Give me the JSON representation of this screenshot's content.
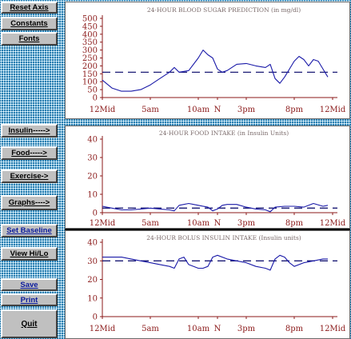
{
  "sidebar": {
    "reset_axis": "Reset Axis",
    "constants": "Constants",
    "fonts": "Fonts",
    "insulin": "Insulin----->",
    "food": "Food----->",
    "exercise": "Exercise->",
    "graphs": "Graphs---->",
    "set_baseline": "Set Baseline",
    "view_hilo": "View Hi/Lo",
    "save": "Save",
    "print": "Print",
    "quit": "Quit"
  },
  "charts": [
    {
      "id": "blood-sugar",
      "title": "24-HOUR BLOOD SUGAR PREDICTION (in mg/dl)",
      "y_ticks": [
        "0",
        "50",
        "100",
        "150",
        "200",
        "250",
        "300",
        "350",
        "400",
        "450",
        "500"
      ],
      "x_ticks": [
        "12Mid",
        "5am",
        "10am",
        "N",
        "3pm",
        "8pm",
        "12Mid"
      ]
    },
    {
      "id": "food",
      "title": "24-HOUR FOOD INTAKE (in Insulin Units)",
      "y_ticks": [
        "0",
        "10",
        "20",
        "30",
        "40"
      ],
      "x_ticks": [
        "12Mid",
        "5am",
        "10am",
        "N",
        "3pm",
        "8pm",
        "12Mid"
      ]
    },
    {
      "id": "bolus",
      "title": "24-HOUR BOLUS INSULIN INTAKE (Insulin units)",
      "y_ticks": [
        "0",
        "10",
        "20",
        "30",
        "40"
      ],
      "x_ticks": [
        "12Mid",
        "5am",
        "10am",
        "N",
        "3pm",
        "8pm",
        "12Mid"
      ]
    }
  ],
  "colors": {
    "axis": "#8b1a1a",
    "series": "#1a1aa8",
    "baseline": "#000066",
    "title": "#7a6a6a"
  },
  "chart_data": [
    {
      "type": "line",
      "title": "24-HOUR BLOOD SUGAR PREDICTION (in mg/dl)",
      "ylim": [
        0,
        500
      ],
      "xlim": [
        0,
        24
      ],
      "x_tick_hours": [
        0,
        5,
        10,
        12,
        15,
        20,
        24
      ],
      "baseline": 160,
      "series": [
        {
          "x": [
            0,
            1,
            2,
            3,
            4,
            5,
            6,
            7,
            7.5,
            8,
            9,
            10,
            10.5,
            11,
            11.5,
            12,
            12.5,
            13,
            14,
            15,
            16,
            17,
            17.5,
            18,
            18.5,
            19,
            20,
            20.5,
            21,
            21.5,
            22,
            22.5,
            23,
            23.5
          ],
          "y": [
            110,
            60,
            40,
            40,
            50,
            80,
            120,
            160,
            190,
            160,
            170,
            250,
            300,
            270,
            250,
            180,
            160,
            170,
            210,
            215,
            200,
            190,
            210,
            120,
            90,
            130,
            230,
            260,
            240,
            200,
            240,
            230,
            180,
            130
          ]
        }
      ]
    },
    {
      "type": "line",
      "title": "24-HOUR FOOD INTAKE (in Insulin Units)",
      "ylim": [
        0,
        40
      ],
      "xlim": [
        0,
        24
      ],
      "x_tick_hours": [
        0,
        5,
        10,
        12,
        15,
        20,
        24
      ],
      "baseline": 2.5,
      "series": [
        {
          "x": [
            0,
            1,
            2,
            3,
            4,
            5,
            6,
            7,
            7.5,
            8,
            9,
            10,
            11,
            11.5,
            12,
            12.5,
            13,
            14,
            15,
            16,
            17,
            17.5,
            18,
            19,
            20,
            21,
            22,
            23,
            23.5
          ],
          "y": [
            3.5,
            2.5,
            1.5,
            1.5,
            2,
            2.5,
            2,
            1.5,
            1,
            4,
            5,
            4,
            3,
            1,
            2,
            4,
            4.5,
            4.5,
            3,
            2,
            1.5,
            0.5,
            3,
            3.5,
            3.5,
            3,
            5,
            3.5,
            4
          ]
        }
      ]
    },
    {
      "type": "line",
      "title": "24-HOUR BOLUS INSULIN INTAKE (Insulin units)",
      "ylim": [
        0,
        40
      ],
      "xlim": [
        0,
        24
      ],
      "x_tick_hours": [
        0,
        5,
        10,
        12,
        15,
        20,
        24
      ],
      "baseline": 30,
      "series": [
        {
          "x": [
            0,
            1,
            2,
            3,
            4,
            5,
            6,
            7,
            7.5,
            8,
            8.5,
            9,
            10,
            10.5,
            11,
            11.5,
            12,
            13,
            14,
            15,
            16,
            17,
            17.5,
            18,
            18.5,
            19,
            19.5,
            20,
            21,
            22,
            23,
            23.5
          ],
          "y": [
            32,
            32,
            32,
            31,
            30,
            29,
            28,
            27,
            26,
            31,
            32,
            28,
            26,
            26,
            27,
            32,
            33,
            31,
            30,
            29,
            27,
            26,
            25,
            31,
            33,
            32,
            29,
            27,
            29,
            30,
            31,
            31
          ]
        }
      ]
    }
  ]
}
